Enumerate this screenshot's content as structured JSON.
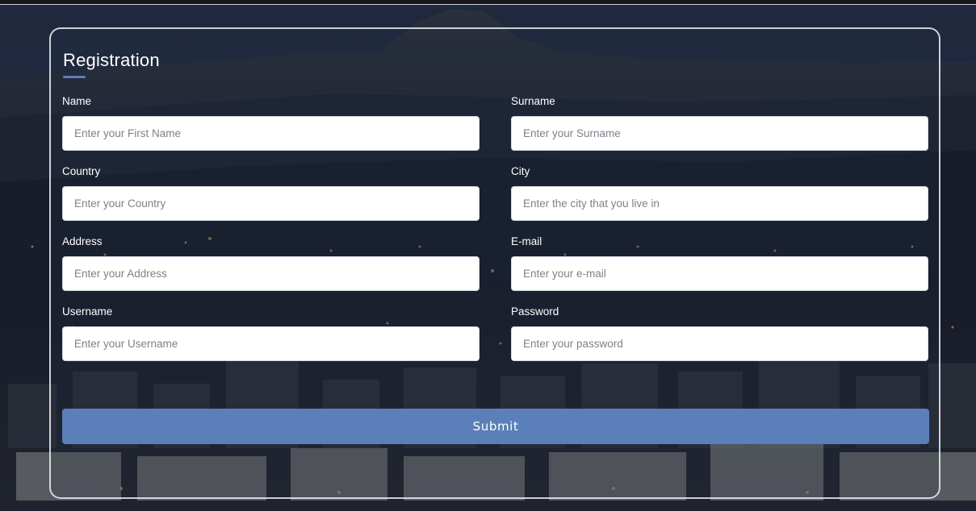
{
  "form": {
    "title": "Registration",
    "accent_color": "#5b7fbf",
    "fields": [
      {
        "label": "Name",
        "placeholder": "Enter your First Name",
        "value": ""
      },
      {
        "label": "Surname",
        "placeholder": "Enter your Surname",
        "value": ""
      },
      {
        "label": "Country",
        "placeholder": "Enter your Country",
        "value": ""
      },
      {
        "label": "City",
        "placeholder": "Enter the city that you live in",
        "value": ""
      },
      {
        "label": "Address",
        "placeholder": "Enter your Address",
        "value": ""
      },
      {
        "label": "E-mail",
        "placeholder": "Enter your e-mail",
        "value": ""
      },
      {
        "label": "Username",
        "placeholder": "Enter your Username",
        "value": ""
      },
      {
        "label": "Password",
        "placeholder": "Enter your password",
        "value": ""
      }
    ],
    "submit_label": "Submit",
    "submit_color": "#5b7fb8"
  }
}
